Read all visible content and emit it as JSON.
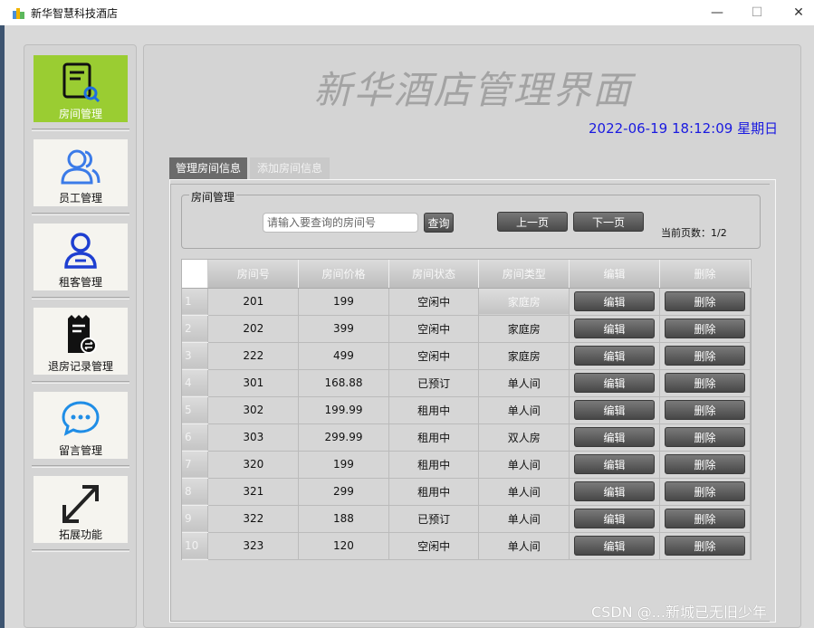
{
  "window": {
    "title": "新华智慧科技酒店",
    "controls": {
      "minimize": "—",
      "maximize": "☐",
      "close": "✕"
    }
  },
  "sidebar": {
    "items": [
      {
        "label": "房间管理",
        "icon": "room-search-icon",
        "active": true
      },
      {
        "label": "员工管理",
        "icon": "staff-icon",
        "active": false
      },
      {
        "label": "租客管理",
        "icon": "tenant-icon",
        "active": false
      },
      {
        "label": "退房记录管理",
        "icon": "checkout-record-icon",
        "active": false
      },
      {
        "label": "留言管理",
        "icon": "message-icon",
        "active": false
      },
      {
        "label": "拓展功能",
        "icon": "expand-icon",
        "active": false
      }
    ]
  },
  "main": {
    "title": "新华酒店管理界面",
    "datetime": "2022-06-19 18:12:09 星期日",
    "tabs": [
      {
        "label": "管理房间信息",
        "active": true
      },
      {
        "label": "添加房间信息",
        "active": false
      }
    ],
    "room_panel": {
      "legend": "房间管理",
      "search_placeholder": "请输入要查询的房间号",
      "query_label": "查询",
      "prev_label": "上一页",
      "next_label": "下一页",
      "page_info": "当前页数：1/2"
    },
    "table": {
      "columns": [
        "房间号",
        "房间价格",
        "房间状态",
        "房间类型",
        "编辑",
        "删除"
      ],
      "edit_label": "编辑",
      "delete_label": "删除",
      "rows": [
        {
          "n": "1",
          "room": "201",
          "price": "199",
          "status": "空闲中",
          "type": "家庭房"
        },
        {
          "n": "2",
          "room": "202",
          "price": "399",
          "status": "空闲中",
          "type": "家庭房"
        },
        {
          "n": "3",
          "room": "222",
          "price": "499",
          "status": "空闲中",
          "type": "家庭房"
        },
        {
          "n": "4",
          "room": "301",
          "price": "168.88",
          "status": "已预订",
          "type": "单人间"
        },
        {
          "n": "5",
          "room": "302",
          "price": "199.99",
          "status": "租用中",
          "type": "单人间"
        },
        {
          "n": "6",
          "room": "303",
          "price": "299.99",
          "status": "租用中",
          "type": "双人房"
        },
        {
          "n": "7",
          "room": "320",
          "price": "199",
          "status": "租用中",
          "type": "单人间"
        },
        {
          "n": "8",
          "room": "321",
          "price": "299",
          "status": "租用中",
          "type": "单人间"
        },
        {
          "n": "9",
          "room": "322",
          "price": "188",
          "status": "已预订",
          "type": "单人间"
        },
        {
          "n": "10",
          "room": "323",
          "price": "120",
          "status": "空闲中",
          "type": "单人间"
        }
      ]
    }
  },
  "watermark": "CSDN @...新城已无旧少年",
  "colors": {
    "accent": "#9acd32",
    "datetime": "#1a1ae0",
    "button": "#555555"
  }
}
